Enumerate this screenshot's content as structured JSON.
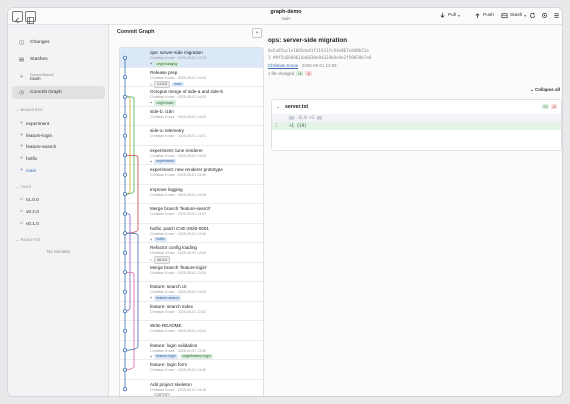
{
  "window": {
    "title": "graph-demo",
    "branch": "main"
  },
  "toolbar": {
    "pull": "Pull",
    "push": "Push",
    "stash": "Stash"
  },
  "sidebar": {
    "nav": [
      {
        "label": "Changes",
        "icon": "changes-icon"
      },
      {
        "label": "Stashes",
        "icon": "stash-icon"
      }
    ],
    "current_branch_label": "Current Branch",
    "current_branch": "main",
    "commit_graph": "Commit Graph",
    "branches_header": "BRANCHES",
    "branches": [
      "experiment",
      "feature-login",
      "feature-search",
      "hotfix",
      "main"
    ],
    "tags_header": "TAGS",
    "tags": [
      "v1.0.0",
      "v0.2.0",
      "v0.1.0"
    ],
    "remotes_header": "REMOTES",
    "remotes_empty": "No remotes"
  },
  "graph": {
    "title": "Commit Graph",
    "commits": [
      {
        "message": "ops: server-side migration",
        "meta": "Christian Kruse · 2025-05-01 14:05",
        "refs": [
          {
            "kind": "remote",
            "label": "origin/staging"
          }
        ]
      },
      {
        "message": "Release prep",
        "meta": "Christian Kruse · 2025-05-01 14:04",
        "refs": [
          {
            "kind": "tag",
            "label": "v1.0.0"
          },
          {
            "kind": "local",
            "label": "main"
          }
        ]
      },
      {
        "message": "Octopus merge of side-a and side-b",
        "meta": "Christian Kruse · 2025-05-01 14:03",
        "refs": [
          {
            "kind": "remote",
            "label": "origin/main"
          }
        ]
      },
      {
        "message": "side-b: i18n",
        "meta": "Christian Kruse · 2025-05-01 14:02",
        "refs": []
      },
      {
        "message": "side-a: telemetry",
        "meta": "Christian Kruse · 2025-05-01 14:01",
        "refs": []
      },
      {
        "message": "experiment: tune renderer",
        "meta": "Christian Kruse · 2025-05-01 14:00",
        "refs": [
          {
            "kind": "local",
            "label": "experiment"
          }
        ]
      },
      {
        "message": "experiment: new renderer prototype",
        "meta": "Christian Kruse · 2025-05-01 13:59",
        "refs": []
      },
      {
        "message": "Improve logging",
        "meta": "Christian Kruse · 2025-05-01 13:58",
        "refs": []
      },
      {
        "message": "Merge branch 'feature-search'",
        "meta": "Christian Kruse · 2025-05-01 13:57",
        "refs": []
      },
      {
        "message": "hotfix: patch CVE-2026-0001",
        "meta": "Christian Kruse · 2025-05-01 13:56",
        "refs": [
          {
            "kind": "local",
            "label": "hotfix"
          }
        ]
      },
      {
        "message": "Refactor config loading",
        "meta": "Christian Kruse · 2025-05-01 13:55",
        "refs": [
          {
            "kind": "tag",
            "label": "v0.2.0"
          }
        ]
      },
      {
        "message": "Merge branch 'feature-login'",
        "meta": "Christian Kruse · 2025-05-01 13:54",
        "refs": []
      },
      {
        "message": "feature: search UI",
        "meta": "Christian Kruse · 2025-05-01 13:53",
        "refs": [
          {
            "kind": "local",
            "label": "feature-search"
          }
        ]
      },
      {
        "message": "feature: search index",
        "meta": "Christian Kruse · 2025-05-01 13:52",
        "refs": []
      },
      {
        "message": "Write README",
        "meta": "Christian Kruse · 2025-05-01 13:51",
        "refs": []
      },
      {
        "message": "feature: login validation",
        "meta": "Christian Kruse · 2025-05-01 13:50",
        "refs": [
          {
            "kind": "local",
            "label": "feature-login"
          },
          {
            "kind": "remote",
            "label": "origin/feature-login"
          }
        ]
      },
      {
        "message": "feature: login form",
        "meta": "Christian Kruse · 2025-05-01 13:49",
        "refs": []
      },
      {
        "message": "Add project skeleton",
        "meta": "Christian Kruse · 2025-05-01 13:48",
        "refs": [
          {
            "kind": "tag",
            "label": "v0.1.0"
          }
        ]
      }
    ]
  },
  "detail": {
    "title": "ops: server-side migration",
    "hash": "6e5a85ac1e1805de01f11931fc94e867e8d8b51e",
    "parent": "1 ##f5a6068614a6830e8d334b0e9e2f98058b7e8",
    "author": "Christian Kruse",
    "date": " · 2025-05-01 14:05",
    "files_changed": "1 file changed",
    "adds": "+1",
    "dels": "-0",
    "collapse_all": "Collapse all",
    "file": {
      "name": "server.txt",
      "adds": "+1",
      "dels": "-0",
      "hunk": "@@ -0,0 +1 @@",
      "line_no": "1",
      "line": "+1 {19}"
    }
  }
}
